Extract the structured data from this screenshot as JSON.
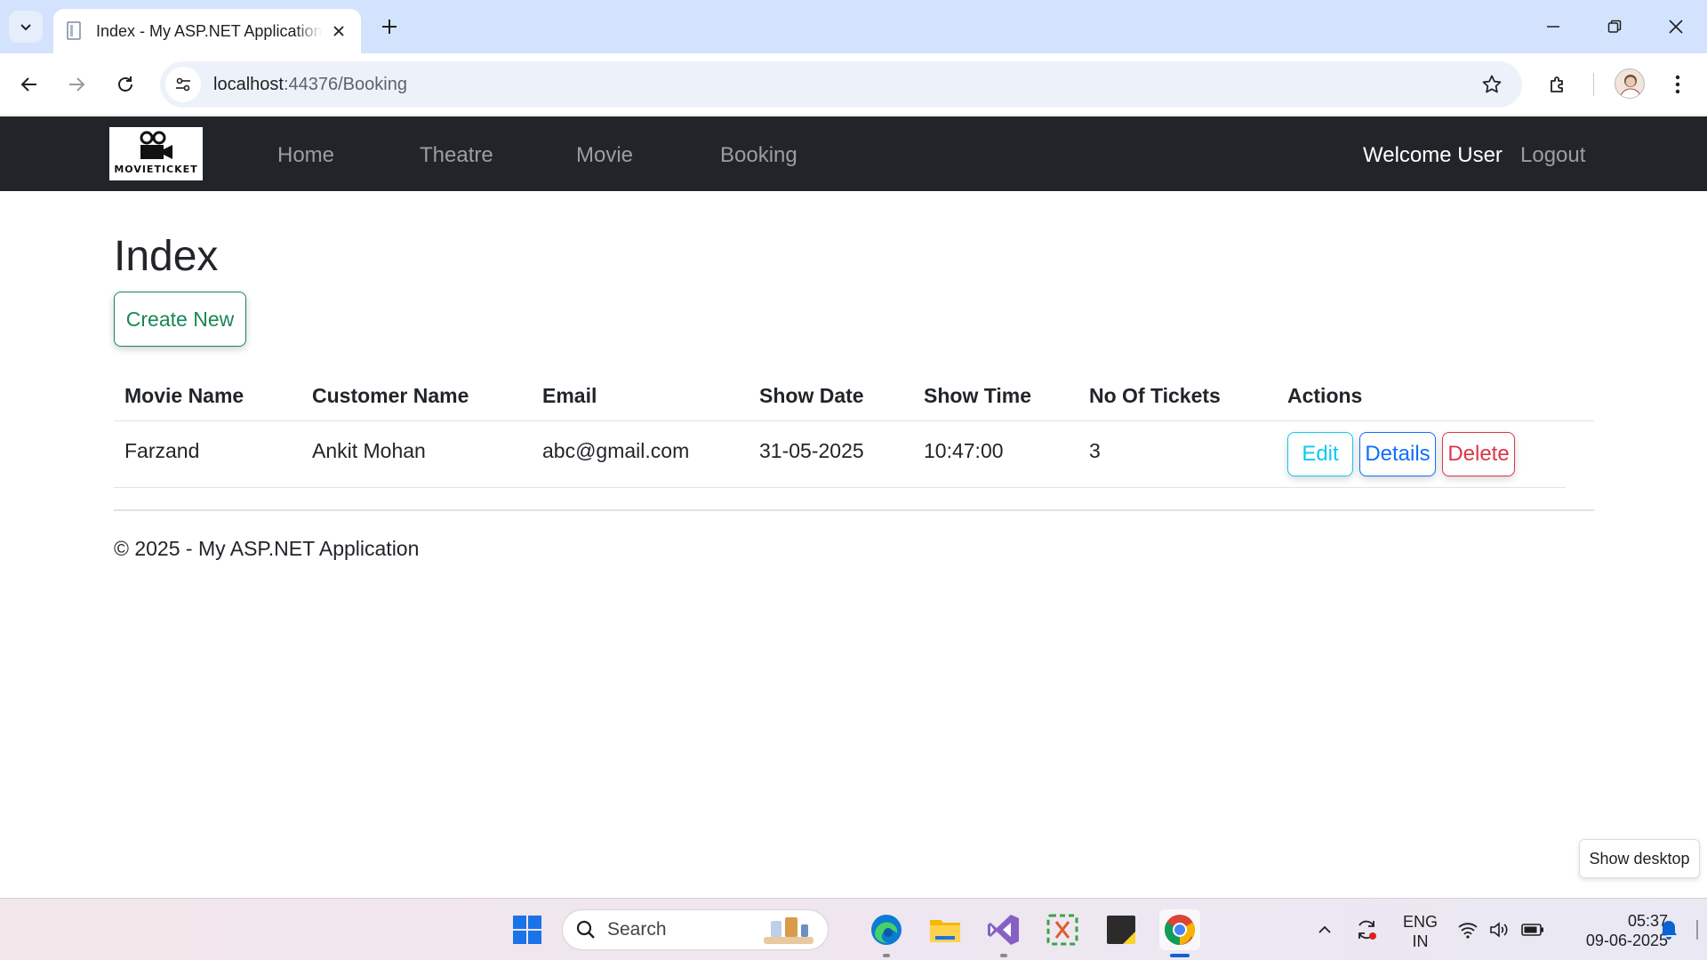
{
  "browser": {
    "tab_title": "Index - My ASP.NET Application",
    "url_host": "localhost",
    "url_path": ":44376/Booking"
  },
  "navbar": {
    "brand_text": "MOVIETICKET",
    "links": [
      "Home",
      "Theatre",
      "Movie",
      "Booking"
    ],
    "welcome": "Welcome User",
    "logout": "Logout"
  },
  "main": {
    "title": "Index",
    "create_new": "Create New",
    "table": {
      "headers": [
        "Movie Name",
        "Customer Name",
        "Email",
        "Show Date",
        "Show Time",
        "No Of Tickets",
        "Actions"
      ],
      "rows": [
        {
          "movie_name": "Farzand",
          "customer_name": "Ankit Mohan",
          "email": "abc@gmail.com",
          "show_date": "31-05-2025",
          "show_time": "10:47:00",
          "tickets": "3",
          "actions": {
            "edit": "Edit",
            "details": "Details",
            "delete": "Delete"
          }
        }
      ]
    }
  },
  "footer": {
    "text": "© 2025 - My ASP.NET Application"
  },
  "tooltip": {
    "show_desktop": "Show desktop"
  },
  "taskbar": {
    "search_label": "Search",
    "lang_line1": "ENG",
    "lang_line2": "IN",
    "time": "05:37",
    "date": "09-06-2025"
  },
  "colors": {
    "navbar_bg": "#212529",
    "success": "#198754",
    "info": "#0dcaf0",
    "primary": "#0d6efd",
    "danger": "#dc3545",
    "tabbar_bg": "#d3e3fd"
  },
  "icons": {
    "tab_favicon": "page-icon",
    "brand_logo": "movie-camera-icon",
    "taskbar": [
      "windows-start-icon",
      "search-icon",
      "edge-icon",
      "file-explorer-icon",
      "visual-studio-icon",
      "snipping-tool-icon",
      "sticky-notes-icon",
      "chrome-icon"
    ],
    "tray": [
      "chevron-up-icon",
      "sync-icon",
      "wifi-icon",
      "volume-icon",
      "battery-icon",
      "notification-bell-icon"
    ]
  }
}
